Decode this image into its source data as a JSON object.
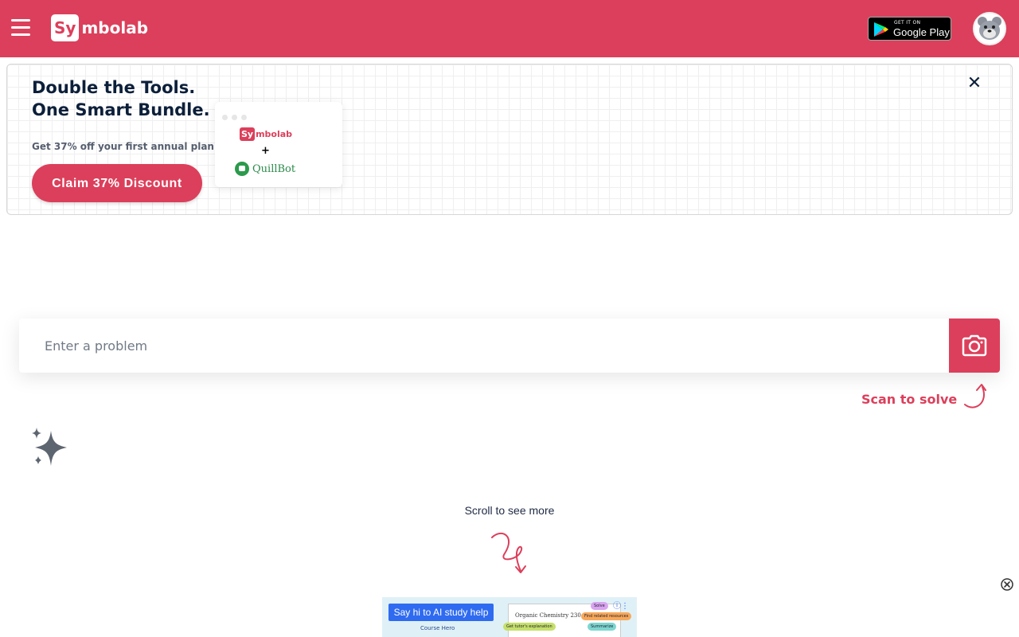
{
  "header": {
    "logo": {
      "badge": "Sy",
      "rest": "mbolab"
    },
    "google_play": {
      "small": "GET IT ON",
      "big": "Google Play"
    }
  },
  "promo": {
    "title_line1": "Double the Tools.",
    "title_line2": "One Smart Bundle.",
    "subtitle": "Get 37% off your first annual plan!",
    "cta": "Claim 37% Discount",
    "card": {
      "logo_badge": "Sy",
      "logo_rest": "mbolab",
      "plus": "+",
      "partner": "QuillBot"
    },
    "close": "✕"
  },
  "search": {
    "placeholder": "Enter a problem",
    "scan_label": "Scan to solve"
  },
  "scroll_hint": "Scroll to see more",
  "ad": {
    "button": "Say hi to AI study help",
    "brand": "Course Hero",
    "doc_title": "Organic Chemistry 230",
    "chips": [
      "Get tutor's explanation",
      "Find related resources",
      "Summarize",
      "Solve"
    ]
  },
  "colors": {
    "brand": "#dc3f5b",
    "navy": "#0c1f3a",
    "quillbot": "#2b8a4a"
  }
}
